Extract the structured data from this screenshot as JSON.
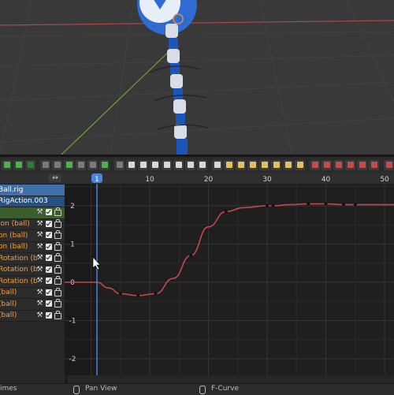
{
  "channels": {
    "swap_label": "↔",
    "rows": [
      {
        "kind": "obj",
        "label": "Ball.rig"
      },
      {
        "kind": "act",
        "label": "RigAction.003"
      },
      {
        "kind": "grp",
        "label": ""
      },
      {
        "kind": "ch",
        "label": "ion (ball)",
        "orange": true
      },
      {
        "kind": "ch",
        "label": "on (ball)",
        "orange": true
      },
      {
        "kind": "ch",
        "label": "on (ball)",
        "orange": true
      },
      {
        "kind": "ch",
        "label": "Rotation (b",
        "orange": true
      },
      {
        "kind": "ch",
        "label": "Rotation (b",
        "orange": true
      },
      {
        "kind": "ch",
        "label": "Rotation (b",
        "orange": true
      },
      {
        "kind": "ch",
        "label": "(ball)",
        "orange": true
      },
      {
        "kind": "ch",
        "label": "(ball)",
        "orange": true
      },
      {
        "kind": "ch",
        "label": "(ball)",
        "orange": true
      }
    ]
  },
  "graph": {
    "current_frame": "1",
    "frame_ticks": [
      "1",
      "10",
      "20",
      "30",
      "40",
      "50"
    ],
    "value_ticks": [
      "2",
      "1",
      "0",
      "-1",
      "-2"
    ]
  },
  "chart_data": {
    "type": "line",
    "x_unit": "frame",
    "keyframes_x": [
      -10,
      5,
      8,
      11,
      17,
      23,
      30,
      31,
      37,
      40,
      43,
      45
    ],
    "keyframes_y": [
      0,
      -0.3,
      -0.35,
      -0.3,
      0.7,
      1.85,
      2.0,
      2.0,
      2.05,
      2.05,
      2.03,
      2.03
    ],
    "curve_x": [
      -10,
      1,
      3,
      5,
      8,
      11,
      14,
      17,
      20,
      23,
      26,
      30,
      31,
      34,
      37,
      40,
      43,
      45,
      60
    ],
    "curve_y": [
      0,
      0,
      -0.15,
      -0.3,
      -0.35,
      -0.3,
      0.1,
      0.7,
      1.45,
      1.85,
      1.95,
      2.0,
      2.0,
      2.03,
      2.05,
      2.05,
      2.03,
      2.03,
      2.03
    ],
    "ylim": [
      -2.2,
      2.3
    ],
    "xlim": [
      -15,
      54
    ],
    "grid": true,
    "curve_color": "#c7454f"
  },
  "statusbar": {
    "left": "imes",
    "pan": "Pan View",
    "fcurve": "F-Curve"
  },
  "colors": {
    "playhead": "#4a84d6",
    "selected_obj": "#3e6fa9",
    "group": "#3c5e2e"
  }
}
